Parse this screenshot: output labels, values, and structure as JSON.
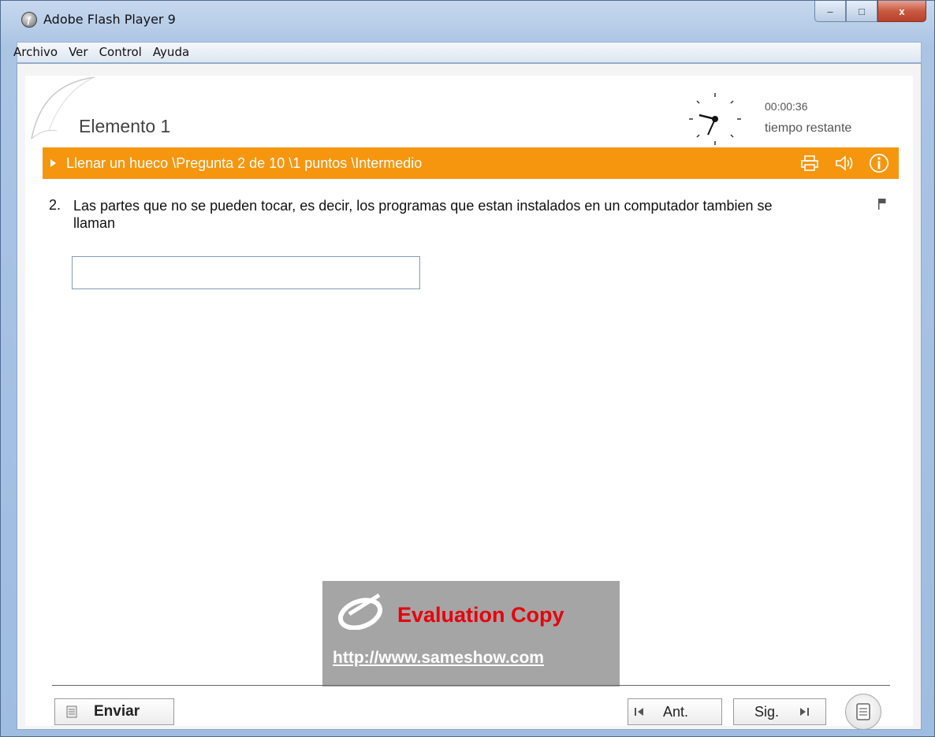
{
  "window": {
    "title": "Adobe Flash Player 9",
    "minimize_label": "–",
    "maximize_label": "□",
    "close_label": "x"
  },
  "menu": [
    "Archivo",
    "Ver",
    "Control",
    "Ayuda"
  ],
  "quiz": {
    "element_title": "Elemento 1",
    "timer": {
      "value": "00:00:36",
      "label": "tiempo restante"
    },
    "question_bar": "Llenar un hueco \\Pregunta 2 de  10 \\1 puntos \\Intermedio",
    "question_number": "2.",
    "question_text": "Las partes que no se pueden tocar, es decir, los  programas que estan instalados en un computador tambien se llaman",
    "answer_value": "",
    "icons": [
      "print-icon",
      "sound-icon",
      "info-icon",
      "flag-icon",
      "clock-icon",
      "notes-icon"
    ]
  },
  "watermark": {
    "text": "Evaluation Copy",
    "url": "http://www.sameshow.com"
  },
  "footer": {
    "send_label": "Enviar",
    "prev_label": "Ant.",
    "next_label": "Sig."
  },
  "colors": {
    "accent": "#f6960e",
    "watermark_bg": "#a5a5a5",
    "watermark_text": "#e8000b"
  }
}
